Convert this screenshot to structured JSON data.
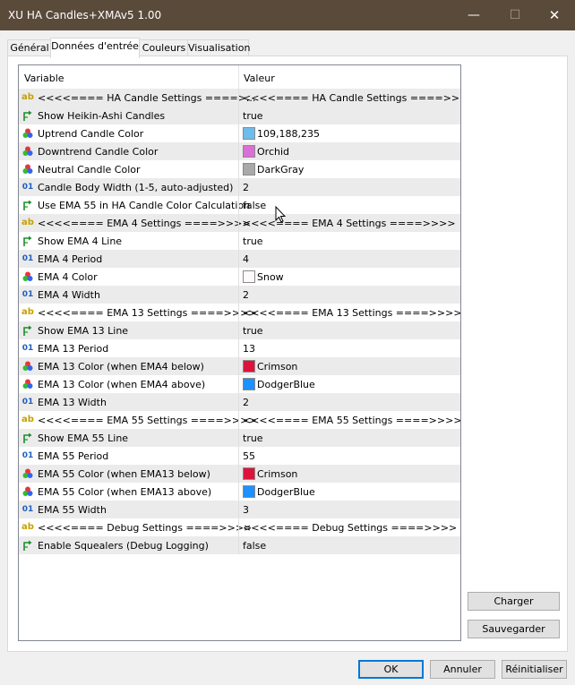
{
  "window": {
    "title": "XU HA Candles+XMAv5 1.00",
    "min_icon": "—",
    "max_icon": "☐",
    "close_icon": "✕"
  },
  "tabs": [
    {
      "label": "Général"
    },
    {
      "label": "Données d'entrée"
    },
    {
      "label": "Couleurs"
    },
    {
      "label": "Visualisation"
    }
  ],
  "grid": {
    "col_variable": "Variable",
    "col_value": "Valeur",
    "rows": [
      {
        "type": "ab",
        "name": "<<<<==== HA Candle Settings ====>...",
        "value": "<<<<==== HA Candle Settings ====>>>>",
        "grey": true
      },
      {
        "type": "bool",
        "name": "Show Heikin-Ashi Candles",
        "value": "true",
        "grey": true
      },
      {
        "type": "color",
        "name": "Uptrend Candle Color",
        "value": "109,188,235",
        "swatch": "#6dbceb",
        "grey": false
      },
      {
        "type": "color",
        "name": "Downtrend Candle Color",
        "value": "Orchid",
        "swatch": "#da70d6",
        "grey": true
      },
      {
        "type": "color",
        "name": "Neutral Candle Color",
        "value": "DarkGray",
        "swatch": "#a9a9a9",
        "grey": false
      },
      {
        "type": "num",
        "name": "Candle Body Width (1-5, auto-adjusted)",
        "value": "2",
        "grey": true
      },
      {
        "type": "bool",
        "name": "Use EMA 55 in HA Candle Color Calculation",
        "value": "false",
        "grey": false
      },
      {
        "type": "ab",
        "name": "<<<<==== EMA 4 Settings ====>>>>",
        "value": "<<<<==== EMA 4 Settings ====>>>>",
        "grey": true
      },
      {
        "type": "bool",
        "name": "Show EMA 4 Line",
        "value": "true",
        "grey": false
      },
      {
        "type": "num",
        "name": "EMA 4 Period",
        "value": "4",
        "grey": true
      },
      {
        "type": "color",
        "name": "EMA 4 Color",
        "value": "Snow",
        "swatch": "#fffafa",
        "grey": false
      },
      {
        "type": "num",
        "name": "EMA 4 Width",
        "value": "2",
        "grey": true
      },
      {
        "type": "ab",
        "name": "<<<<==== EMA 13 Settings ====>>>>",
        "value": "<<<<==== EMA 13 Settings ====>>>>",
        "grey": false
      },
      {
        "type": "bool",
        "name": "Show EMA 13 Line",
        "value": "true",
        "grey": true
      },
      {
        "type": "num",
        "name": "EMA 13 Period",
        "value": "13",
        "grey": false
      },
      {
        "type": "color",
        "name": "EMA 13 Color (when EMA4 below)",
        "value": "Crimson",
        "swatch": "#dc143c",
        "grey": true
      },
      {
        "type": "color",
        "name": "EMA 13 Color (when EMA4 above)",
        "value": "DodgerBlue",
        "swatch": "#1e90ff",
        "grey": false
      },
      {
        "type": "num",
        "name": "EMA 13 Width",
        "value": "2",
        "grey": true
      },
      {
        "type": "ab",
        "name": "<<<<==== EMA 55 Settings ====>>>>",
        "value": "<<<<==== EMA 55 Settings ====>>>>",
        "grey": false
      },
      {
        "type": "bool",
        "name": "Show EMA 55 Line",
        "value": "true",
        "grey": true
      },
      {
        "type": "num",
        "name": "EMA 55 Period",
        "value": "55",
        "grey": false
      },
      {
        "type": "color",
        "name": "EMA 55 Color (when EMA13 below)",
        "value": "Crimson",
        "swatch": "#dc143c",
        "grey": true
      },
      {
        "type": "color",
        "name": "EMA 55 Color (when EMA13 above)",
        "value": "DodgerBlue",
        "swatch": "#1e90ff",
        "grey": false
      },
      {
        "type": "num",
        "name": "EMA 55 Width",
        "value": "3",
        "grey": true
      },
      {
        "type": "ab",
        "name": "<<<<==== Debug Settings ====>>>>",
        "value": "<<<<==== Debug Settings ====>>>>",
        "grey": false
      },
      {
        "type": "bool",
        "name": "Enable Squealers (Debug Logging)",
        "value": "false",
        "grey": true
      }
    ]
  },
  "side_buttons": {
    "load": "Charger",
    "save": "Sauvegarder"
  },
  "footer": {
    "ok": "OK",
    "cancel": "Annuler",
    "reset": "Réinitialiser"
  },
  "colors": {
    "titlebar": "#5a4a3a",
    "row_grey": "#ebebeb",
    "accent": "#0078d7"
  }
}
